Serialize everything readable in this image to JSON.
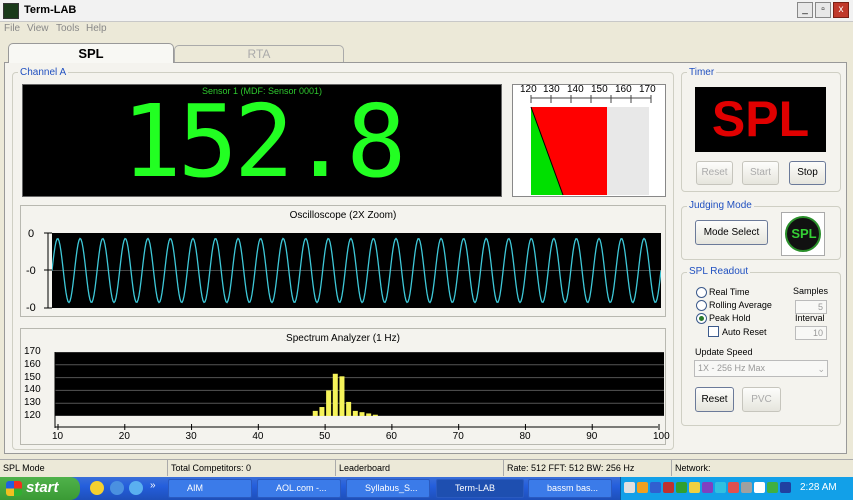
{
  "window": {
    "title": "Term-LAB",
    "min": "_",
    "max": "▫",
    "close": "x"
  },
  "menu": [
    "File",
    "View",
    "Tools",
    "Help"
  ],
  "tabs": [
    {
      "label": "SPL"
    },
    {
      "label": "RTA"
    }
  ],
  "channel": {
    "group_label": "Channel A",
    "sensor": "Sensor 1 (MDF: Sensor 0001)",
    "reading": "152.8",
    "meter_ticks": [
      "120",
      "130",
      "140",
      "150",
      "160",
      "170"
    ]
  },
  "oscilloscope": {
    "title": "Oscilloscope (2X Zoom)",
    "ylabels": [
      "0",
      "-0",
      "-0"
    ]
  },
  "spectrum": {
    "title": "Spectrum Analyzer (1 Hz)",
    "ylabels": [
      "170",
      "160",
      "150",
      "140",
      "130",
      "120"
    ],
    "xlabels": [
      "10",
      "20",
      "30",
      "40",
      "50",
      "60",
      "70",
      "80",
      "90",
      "100"
    ]
  },
  "timer": {
    "group_label": "Timer",
    "display": "SPL",
    "reset": "Reset",
    "start": "Start",
    "stop": "Stop"
  },
  "judging": {
    "group_label": "Judging Mode",
    "mode_select": "Mode Select",
    "logo": "SPL"
  },
  "readout": {
    "group_label": "SPL Readout",
    "samples_label": "Samples",
    "interval_label": "Interval",
    "real_time": "Real Time",
    "rolling_average": "Rolling Average",
    "peak_hold": "Peak Hold",
    "auto_reset": "Auto Reset",
    "samples_value": "5",
    "interval_value": "10",
    "update_speed_label": "Update Speed",
    "update_speed_value": "1X - 256 Hz Max",
    "reset": "Reset",
    "pvc": "PVC"
  },
  "status": {
    "mode": "SPL Mode",
    "competitors": "Total Competitors: 0",
    "leaderboard": "Leaderboard",
    "rate": "Rate: 512 FFT: 512 BW: 256 Hz",
    "network": "Network:"
  },
  "taskbar": {
    "start": "start",
    "items": [
      {
        "label": "AIM"
      },
      {
        "label": "AOL.com -..."
      },
      {
        "label": "Syllabus_S..."
      },
      {
        "label": "Term-LAB"
      },
      {
        "label": "bassm bas..."
      }
    ],
    "clock": "2:28 AM"
  },
  "colors": {
    "accent_green": "#22ff22",
    "spl_red": "#e00000",
    "trace": "#3ec8d8"
  }
}
